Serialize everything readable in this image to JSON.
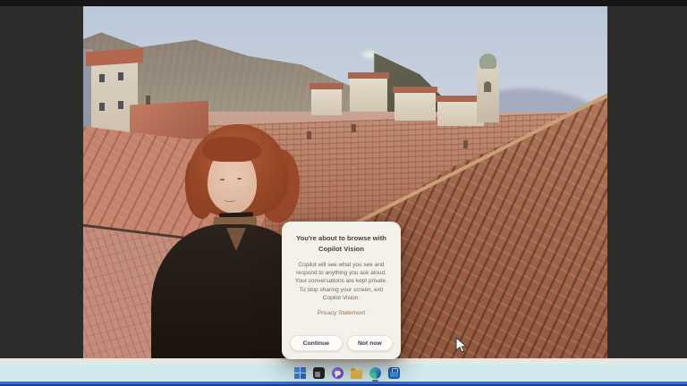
{
  "desktop": {
    "photo_description": "Vintage photo of a woman with auburn hair smiling on a rooftop above the terracotta roofs and bell tower of an old Mediterranean walled town, mountain ridge behind",
    "backdrop_color": "#2e2b2b"
  },
  "dialog": {
    "title_line1": "You're about to browse with",
    "title_line2": "Copilot Vision",
    "body_lines": [
      "Copilot will see what you see and",
      "respond to anything you ask aloud.",
      "Your conversations are kept private.",
      "To stop sharing your screen, exit",
      "Copilot Vision."
    ],
    "privacy_link": "Privacy Statement",
    "continue_label": "Continue",
    "not_now_label": "Not now"
  },
  "taskbar": {
    "icons": [
      {
        "name": "start"
      },
      {
        "name": "dark-app"
      },
      {
        "name": "chat"
      },
      {
        "name": "file-explorer"
      },
      {
        "name": "edge",
        "active": true
      },
      {
        "name": "store"
      }
    ]
  },
  "colors": {
    "taskbar_bg": "#cfe9ec",
    "taskbar_accent_line": "#2e6fe2",
    "dialog_bg": "#f4f1ea",
    "privacy_link": "#9b6f58",
    "woman_hair": "#943d20",
    "roof_terracotta": "#a96a50"
  }
}
